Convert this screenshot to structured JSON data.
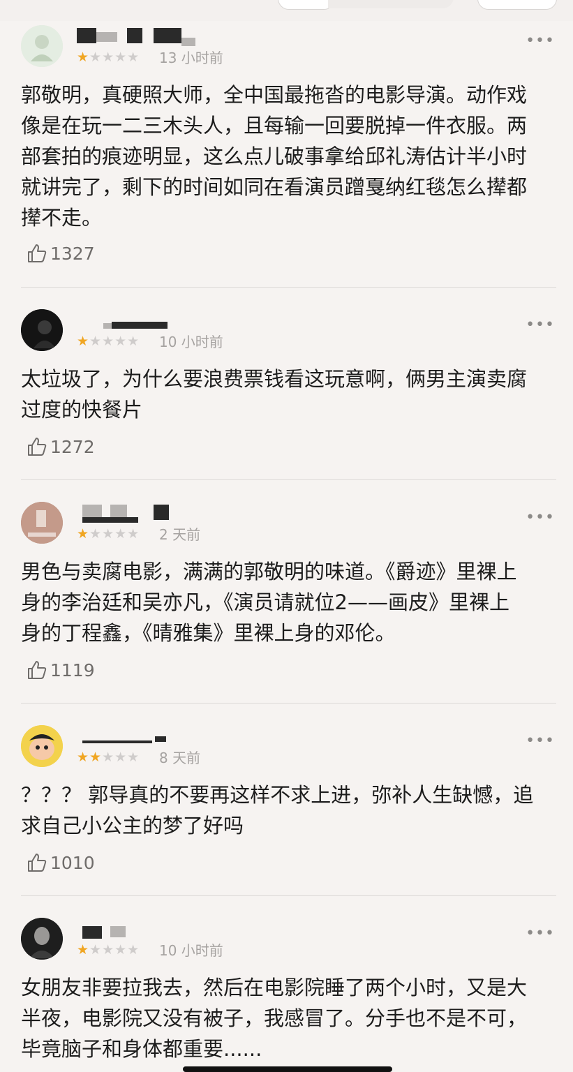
{
  "reviews": [
    {
      "rating": 1,
      "time": "13 小时前",
      "content": "郭敬明，真硬照大师，全中国最拖沓的电影导演。动作戏\n像是在玩一二三木头人，且每输一回要脱掉一件衣服。两\n部套拍的痕迹明显，这么点儿破事拿给邱礼涛估计半小时\n就讲完了，剩下的时间如同在看演员蹭戛纳红毯怎么撵都\n撵不走。",
      "likes": "1327",
      "avatar_color": "#dfe9dc"
    },
    {
      "rating": 1,
      "time": "10 小时前",
      "content": "太垃圾了，为什么要浪费票钱看这玩意啊，俩男主演卖腐\n过度的快餐片",
      "likes": "1272",
      "avatar_color": "#151515"
    },
    {
      "rating": 1,
      "time": "2 天前",
      "content": "男色与卖腐电影，满满的郭敬明的味道。《爵迹》里裸上\n身的李治廷和吴亦凡，《演员请就位2——画皮》里裸上\n身的丁程鑫，《晴雅集》里裸上身的邓伦。",
      "likes": "1119",
      "avatar_color": "#b48a7c"
    },
    {
      "rating": 2,
      "time": "8 天前",
      "content": "？？？ 郭导真的不要再这样不求上进，弥补人生缺憾，追\n求自己小公主的梦了好吗",
      "likes": "1010",
      "avatar_color": "#f2cf4a"
    },
    {
      "rating": 1,
      "time": "10 小时前",
      "content": "女朋友非要拉我去，然后在电影院睡了两个小时，又是大\n半夜，电影院又没有被子，我感冒了。分手也不是不可，\n毕竟脑子和身体都重要......",
      "likes": "",
      "avatar_color": "#2b2b2b"
    }
  ],
  "colors": {
    "background": "#f6f3f1",
    "star_active": "#f0a623",
    "star_inactive": "#cfcccb",
    "time_text": "#a5a2a0"
  },
  "icons": {
    "like": "thumbs-up-icon",
    "more": "more-dots-icon"
  }
}
